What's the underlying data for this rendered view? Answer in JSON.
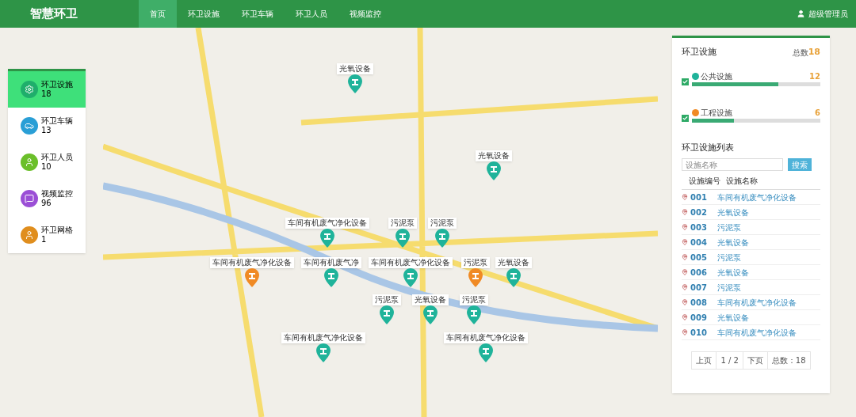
{
  "header": {
    "title": "智慧环卫",
    "nav": [
      {
        "label": "首页",
        "selected": true
      },
      {
        "label": "环卫设施",
        "selected": false
      },
      {
        "label": "环卫车辆",
        "selected": false
      },
      {
        "label": "环卫人员",
        "selected": false
      },
      {
        "label": "视频监控",
        "selected": false
      }
    ],
    "user": "超级管理员"
  },
  "categories": [
    {
      "label": "环卫设施",
      "count": "18",
      "selected": true,
      "kind": "facility",
      "color": "#1fae6b"
    },
    {
      "label": "环卫车辆",
      "count": "13",
      "selected": false,
      "kind": "vehicle",
      "color": "#2a9fd6"
    },
    {
      "label": "环卫人员",
      "count": "10",
      "selected": false,
      "kind": "staff",
      "color": "#6bbf2a"
    },
    {
      "label": "视频监控",
      "count": "96",
      "selected": false,
      "kind": "video",
      "color": "#9b4fd6"
    },
    {
      "label": "环卫网格",
      "count": "1",
      "selected": false,
      "kind": "grid",
      "color": "#e08e1e"
    }
  ],
  "map_markers": [
    {
      "label": "光氧设备",
      "kind": "public"
    },
    {
      "label": "光氧设备",
      "kind": "public"
    },
    {
      "label": "车间有机废气净化设备",
      "kind": "public"
    },
    {
      "label": "污泥泵",
      "kind": "public"
    },
    {
      "label": "污泥泵",
      "kind": "public"
    },
    {
      "label": "车间有机废气净化设备",
      "kind": "industrial"
    },
    {
      "label": "车间有机废气净",
      "kind": "public"
    },
    {
      "label": "车间有机废气净化设备",
      "kind": "public"
    },
    {
      "label": "污泥泵",
      "kind": "industrial"
    },
    {
      "label": "光氧设备",
      "kind": "public"
    },
    {
      "label": "污泥泵",
      "kind": "public"
    },
    {
      "label": "光氧设备",
      "kind": "public"
    },
    {
      "label": "污泥泵",
      "kind": "public"
    },
    {
      "label": "车间有机废气净化设备",
      "kind": "public"
    },
    {
      "label": "车间有机废气净化设备",
      "kind": "public"
    }
  ],
  "facility_panel": {
    "title": "环卫设施",
    "total_label": "总数",
    "total": "18",
    "groups": [
      {
        "label": "公共设施",
        "count": "12",
        "checked": true,
        "level": 0.67,
        "kind": "public"
      },
      {
        "label": "工程设施",
        "count": "6",
        "checked": true,
        "level": 0.33,
        "kind": "industrial"
      }
    ],
    "list_title": "环卫设施列表",
    "search": {
      "placeholder": "设施名称",
      "button": "搜索"
    },
    "columns": [
      "设施编号",
      "设施名称"
    ],
    "rows": [
      {
        "id": "001",
        "name": "车间有机废气净化设备"
      },
      {
        "id": "002",
        "name": "光氧设备"
      },
      {
        "id": "003",
        "name": "污泥泵"
      },
      {
        "id": "004",
        "name": "光氧设备"
      },
      {
        "id": "005",
        "name": "污泥泵"
      },
      {
        "id": "006",
        "name": "光氧设备"
      },
      {
        "id": "007",
        "name": "污泥泵"
      },
      {
        "id": "008",
        "name": "车间有机废气净化设备"
      },
      {
        "id": "009",
        "name": "光氧设备"
      },
      {
        "id": "010",
        "name": "车间有机废气净化设备"
      }
    ],
    "pager": {
      "prev": "上页",
      "page": "1 / 2",
      "next": "下页",
      "total": "总数：18"
    }
  }
}
